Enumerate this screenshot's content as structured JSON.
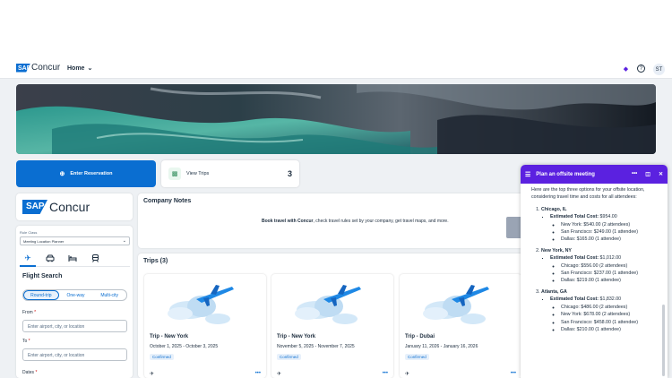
{
  "header": {
    "logo_sap": "SAP",
    "logo_name": "Concur",
    "home_label": "Home",
    "avatar_initials": "ST"
  },
  "actions": {
    "enter_reservation": "Enter Reservation",
    "view_trips": "View Trips",
    "view_trips_count": "3"
  },
  "booking": {
    "logo_sap": "SAP",
    "logo_name": "Concur",
    "rule_class_label": "Rule Class",
    "rule_class_value": "Meeting Location Planner",
    "title": "Flight Search",
    "trip_types": [
      "Round-trip",
      "One-way",
      "Multi-city"
    ],
    "from_label": "From",
    "from_placeholder": "Enter airport, city, or location",
    "to_label": "To",
    "to_placeholder": "Enter airport, city, or location",
    "dates_label": "Dates",
    "required_mark": "*"
  },
  "notes": {
    "title": "Company Notes",
    "text_bold": "Book travel with Concur",
    "text_rest": ", check travel rules set by your company, get travel maps, and more."
  },
  "trips": {
    "title": "Trips (3)",
    "items": [
      {
        "name": "Trip - New York",
        "dates": "October 1, 2025 - October 3, 2025",
        "status": "Confirmed"
      },
      {
        "name": "Trip - New York",
        "dates": "November 5, 2025 - November 7, 2025",
        "status": "Confirmed"
      },
      {
        "name": "Trip - Dubai",
        "dates": "January 11, 2026 - January 16, 2026",
        "status": "Confirmed"
      }
    ],
    "more": "•••"
  },
  "assistant": {
    "title": "Plan an offsite meeting",
    "intro": "Here are the top three options for your offsite location, considering travel time and costs for all attendees:",
    "options": [
      {
        "city": "Chicago, IL",
        "total_label": "Estimated Total Cost:",
        "total": "$954.00",
        "items": [
          "New York: $540.00 (2 attendees)",
          "San Francisco: $249.00 (1 attendee)",
          "Dallas: $165.00 (1 attendee)"
        ]
      },
      {
        "city": "New York, NY",
        "total_label": "Estimated Total Cost:",
        "total": "$1,012.00",
        "items": [
          "Chicago: $556.00 (2 attendees)",
          "San Francisco: $237.00 (1 attendee)",
          "Dallas: $219.00 (1 attendee)"
        ]
      },
      {
        "city": "Atlanta, GA",
        "total_label": "Estimated Total Cost:",
        "total": "$1,832.00",
        "items": [
          "Chicago: $486.00 (2 attendees)",
          "New York: $678.00 (2 attendees)",
          "San Francisco: $458.00 (1 attendee)",
          "Dallas: $210.00 (1 attendee)"
        ]
      }
    ]
  },
  "colors": {
    "brand_blue": "#0a6ed1",
    "assistant_purple": "#5b21e0",
    "page_bg": "#eef1f4"
  }
}
